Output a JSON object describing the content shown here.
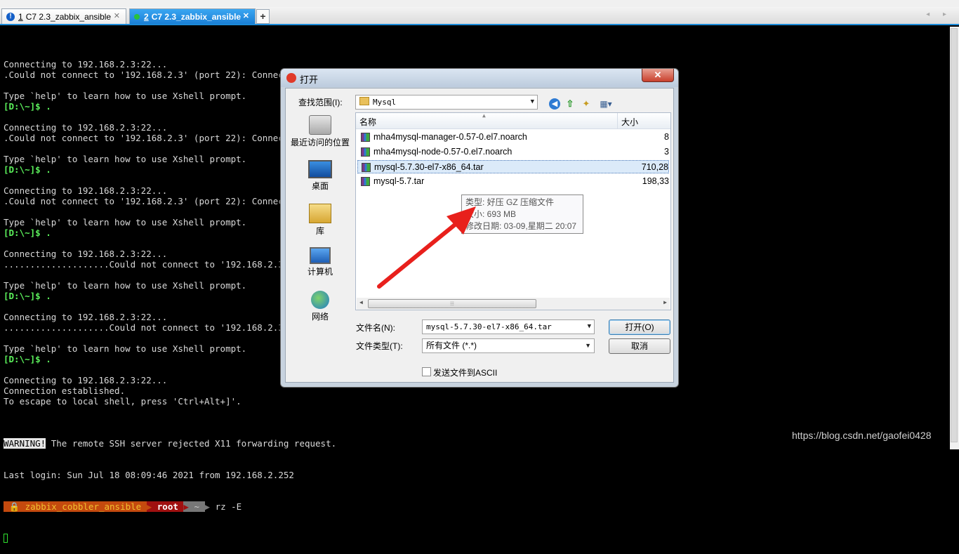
{
  "tabs": [
    {
      "number": "1",
      "label": "C7 2.3_zabbix_ansible",
      "status_icon": "warning-icon",
      "active": false
    },
    {
      "number": "2",
      "label": "C7 2.3_zabbix_ansible",
      "status_icon": "connected-dot-icon",
      "active": true
    }
  ],
  "tab_close_glyph": "✕",
  "new_tab_glyph": "+",
  "nav_arrows": "◂ ▸",
  "terminal": {
    "lines": [
      "Connecting to 192.168.2.3:22...",
      ".Could not connect to '192.168.2.3' (port 22): Connection failed.",
      "",
      "Type `help' to learn how to use Xshell prompt.",
      "[D:\\~]$ .",
      "",
      "Connecting to 192.168.2.3:22...",
      ".Could not connect to '192.168.2.3' (port 22): Connectio",
      "",
      "Type `help' to learn how to use Xshell prompt.",
      "[D:\\~]$ .",
      "",
      "Connecting to 192.168.2.3:22...",
      ".Could not connect to '192.168.2.3' (port 22): Connectio",
      "",
      "Type `help' to learn how to use Xshell prompt.",
      "[D:\\~]$ .",
      "",
      "Connecting to 192.168.2.3:22...",
      "....................Could not connect to '192.168.2.3' (",
      "",
      "Type `help' to learn how to use Xshell prompt.",
      "[D:\\~]$ .",
      "",
      "Connecting to 192.168.2.3:22...",
      "....................Could not connect to '192.168.2.3' (",
      "",
      "Type `help' to learn how to use Xshell prompt.",
      "[D:\\~]$ .",
      "",
      "Connecting to 192.168.2.3:22...",
      "Connection established.",
      "To escape to local shell, press 'Ctrl+Alt+]'.",
      ""
    ],
    "warning_label": "WARNING!",
    "warning_text": " The remote SSH server rejected X11 forwarding request.",
    "last_login": "Last login: Sun Jul 18 08:09:46 2021 from 192.168.2.252",
    "ps_user": " 🔒 zabbix_cobbler_ansible ",
    "ps_root": " root ",
    "ps_dir": " ~ ",
    "ps_command": " rz -E"
  },
  "dialog": {
    "title": "打开",
    "close_glyph": "✕",
    "lookin_label": "查找范围(I):",
    "lookin_value": "Mysql",
    "places": [
      "最近访问的位置",
      "桌面",
      "库",
      "计算机",
      "网络"
    ],
    "columns": {
      "name": "名称",
      "size": "大小"
    },
    "files": [
      {
        "name": "mha4mysql-manager-0.57-0.el7.noarch",
        "size": "8"
      },
      {
        "name": "mha4mysql-node-0.57-0.el7.noarch",
        "size": "3"
      },
      {
        "name": "mysql-5.7.30-el7-x86_64.tar",
        "size": "710,28"
      },
      {
        "name": "mysql-5.7.tar",
        "size": "198,33"
      }
    ],
    "tooltip": {
      "type": "类型: 好压 GZ 压缩文件",
      "size": "大小: 693 MB",
      "modified": "修改日期: 03-09,星期二 20:07"
    },
    "hscroll_grip": "⦙⦙⦙",
    "filename_label": "文件名(N):",
    "filename_value": "mysql-5.7.30-el7-x86_64.tar",
    "filetype_label": "文件类型(T):",
    "filetype_value": "所有文件 (*.*)",
    "open_button": "打开(O)",
    "cancel_button": "取消",
    "ascii_checkbox": "发送文件到ASCII"
  },
  "watermark": "https://blog.csdn.net/gaofei0428",
  "colors": {
    "prompt_green": "#5cf25c",
    "tab_active": "#1b80d6",
    "arrow_red": "#e8201c"
  }
}
